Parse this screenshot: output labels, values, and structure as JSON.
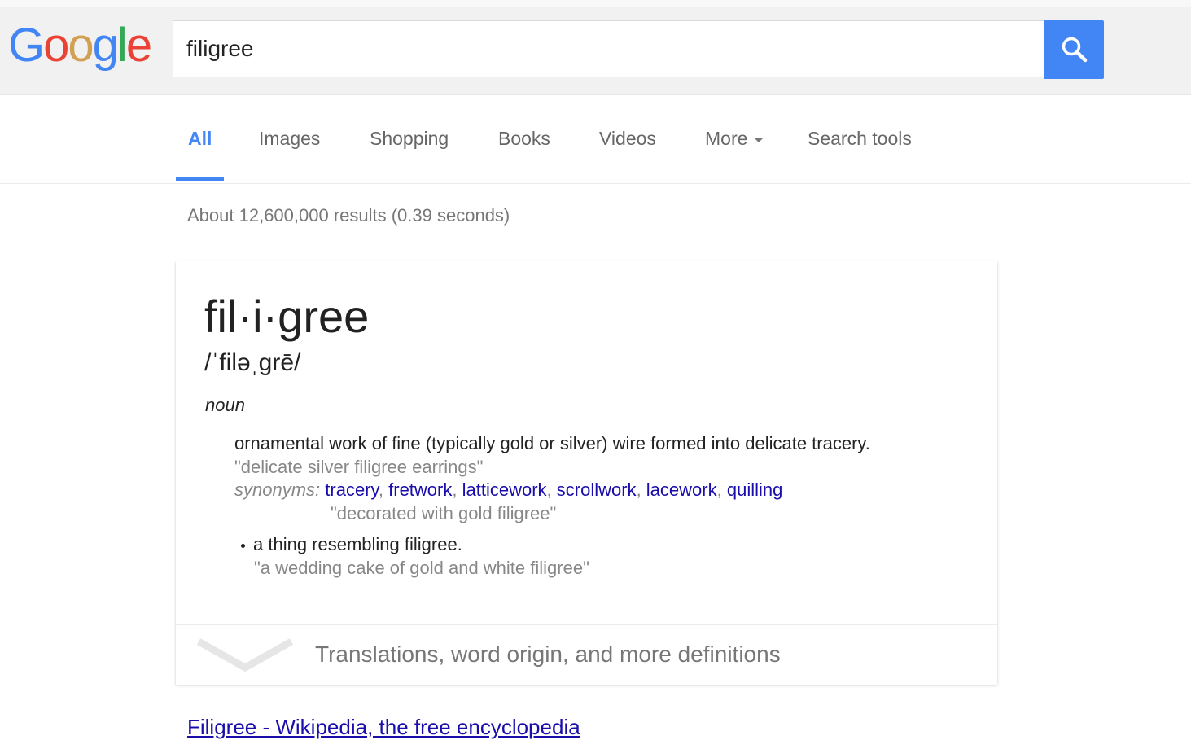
{
  "logo": {
    "text": [
      "G",
      "o",
      "o",
      "g",
      "l",
      "e"
    ]
  },
  "search": {
    "query": "filigree"
  },
  "tabs": [
    {
      "label": "All",
      "active": true
    },
    {
      "label": "Images"
    },
    {
      "label": "Shopping"
    },
    {
      "label": "Books"
    },
    {
      "label": "Videos"
    },
    {
      "label": "More"
    },
    {
      "label": "Search tools"
    }
  ],
  "stats": "About 12,600,000 results (0.39 seconds)",
  "dictionary": {
    "word": "fil·i·gree",
    "phonetic": "/ˈfiləˌgrē/",
    "part_of_speech": "noun",
    "definition": "ornamental work of fine (typically gold or silver) wire formed into delicate tracery.",
    "example": "\"delicate silver filigree earrings\"",
    "synonyms_label": "synonyms:",
    "synonyms": [
      "tracery",
      "fretwork",
      "latticework",
      "scrollwork",
      "lacework",
      "quilling"
    ],
    "synonym_example": "\"decorated with gold filigree\"",
    "sub_definition": "a thing resembling filigree.",
    "sub_example": "\"a wedding cake of gold and white filigree\"",
    "more_label": "Translations, word origin, and more definitions"
  },
  "next_result": "Filigree - Wikipedia, the free encyclopedia",
  "colors": {
    "accent": "#4285f4",
    "link": "#1a0dab",
    "muted": "#878787"
  }
}
